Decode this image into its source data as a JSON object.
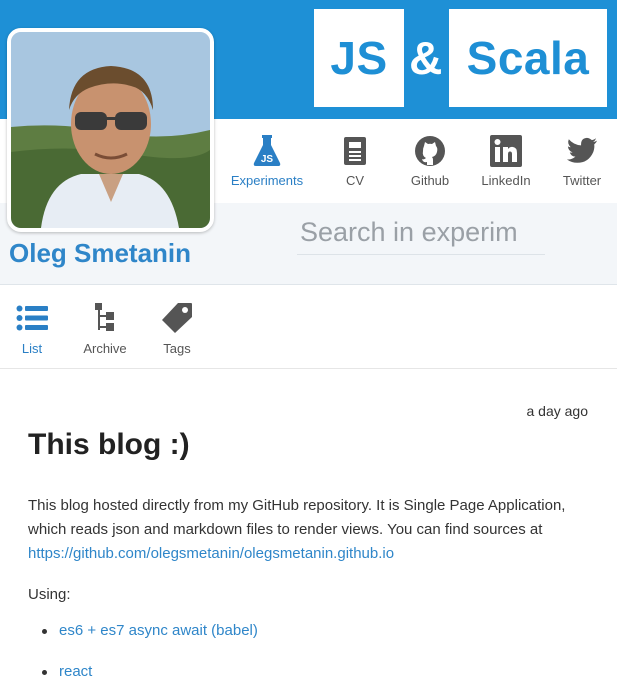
{
  "logo": {
    "js": "JS",
    "amp": "&",
    "scala": "Scala"
  },
  "colors": {
    "brand_blue": "#1e90d6",
    "link_blue": "#2f86c9",
    "icon_gray": "#555555"
  },
  "nav": {
    "items": [
      {
        "label": "Experiments",
        "icon": "flask-js-icon",
        "active": true
      },
      {
        "label": "CV",
        "icon": "document-icon"
      },
      {
        "label": "Github",
        "icon": "github-icon"
      },
      {
        "label": "LinkedIn",
        "icon": "linkedin-icon"
      },
      {
        "label": "Twitter",
        "icon": "twitter-icon"
      }
    ]
  },
  "search": {
    "placeholder": "Search in experim",
    "value": ""
  },
  "profile": {
    "name": "Oleg Smetanin"
  },
  "tabs": [
    {
      "label": "List",
      "icon": "list-icon",
      "active": true
    },
    {
      "label": "Archive",
      "icon": "tree-icon"
    },
    {
      "label": "Tags",
      "icon": "tag-icon"
    }
  ],
  "post": {
    "date": "a day ago",
    "title": "This blog :)",
    "body_text": "This blog hosted directly from my GitHub repository. It is Single Page Application, which reads json and markdown files to render views. You can find sources at ",
    "source_link": "https://github.com/olegsmetanin/olegsmetanin.github.io",
    "using_label": "Using:",
    "list": [
      "es6 + es7 async await (babel)",
      "react"
    ]
  }
}
